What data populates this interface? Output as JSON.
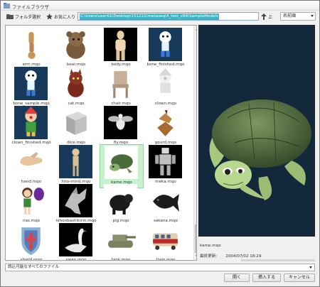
{
  "window": {
    "title": "ファイルブラウザ"
  },
  "toolbar": {
    "folder_button": "フォルダ選択",
    "favorites_button": "お気に入り",
    "path": "C:\\Users\\user01\\Desktop\\151221\\metaseq\\4_test_x64\\SampleModels",
    "up_button": "上",
    "sort_value": "名前順"
  },
  "files": [
    {
      "name": "arm.mqo",
      "bg": "#ffffff",
      "icon": "arm"
    },
    {
      "name": "bear.mqo",
      "bg": "#ffffff",
      "icon": "bear"
    },
    {
      "name": "body.mqo",
      "bg": "#000000",
      "icon": "body"
    },
    {
      "name": "bone_finished.mqo",
      "bg": "#173a5a",
      "icon": "bone-character"
    },
    {
      "name": "bone_sample.mqo",
      "bg": "#173a5a",
      "icon": "bone-character"
    },
    {
      "name": "cat.mqo",
      "bg": "#ffffff",
      "icon": "cat"
    },
    {
      "name": "chair.mqo",
      "bg": "#ffffff",
      "icon": "chair"
    },
    {
      "name": "clown.mqo",
      "bg": "#ffffff",
      "icon": "clown"
    },
    {
      "name": "clown_finished.mqo",
      "bg": "#173a5a",
      "icon": "clown-finished"
    },
    {
      "name": "dice.mqo",
      "bg": "#ffffff",
      "icon": "dice"
    },
    {
      "name": "fly.mqo",
      "bg": "#000000",
      "icon": "fly"
    },
    {
      "name": "gourd.mqo",
      "bg": "#ffffff",
      "icon": "gourd"
    },
    {
      "name": "hand.mqo",
      "bg": "#ffffff",
      "icon": "hand"
    },
    {
      "name": "hito-mind.mqo",
      "bg": "#173a5a",
      "icon": "figure"
    },
    {
      "name": "kame.mqo",
      "bg": "#ffffff",
      "icon": "turtle",
      "selected": true
    },
    {
      "name": "meka.mqo",
      "bg": "#000000",
      "icon": "robot"
    },
    {
      "name": "nas.mqo",
      "bg": "#ffffff",
      "icon": "girl"
    },
    {
      "name": "nihonbashikirin.mqo",
      "bg": "#000000",
      "icon": "kirin"
    },
    {
      "name": "pig.mqo",
      "bg": "#ffffff",
      "icon": "pig"
    },
    {
      "name": "sakana.mqo",
      "bg": "#ffffff",
      "icon": "fish"
    },
    {
      "name": "shield.mqo",
      "bg": "#ffffff",
      "icon": "shield"
    },
    {
      "name": "swan.mqo",
      "bg": "#000000",
      "icon": "swan"
    },
    {
      "name": "tank.mqo",
      "bg": "#ffffff",
      "icon": "tank"
    },
    {
      "name": "train.mqo",
      "bg": "#ffffff",
      "icon": "train"
    }
  ],
  "preview": {
    "file_name": "kame.mqo",
    "date_label": "最終更新:",
    "date_value": "2004/07/02 18:29"
  },
  "filter": {
    "value": "読込可能なすべてのファイル"
  },
  "buttons": {
    "open": "開く",
    "insert": "挿入する",
    "cancel": "キャンセル"
  }
}
